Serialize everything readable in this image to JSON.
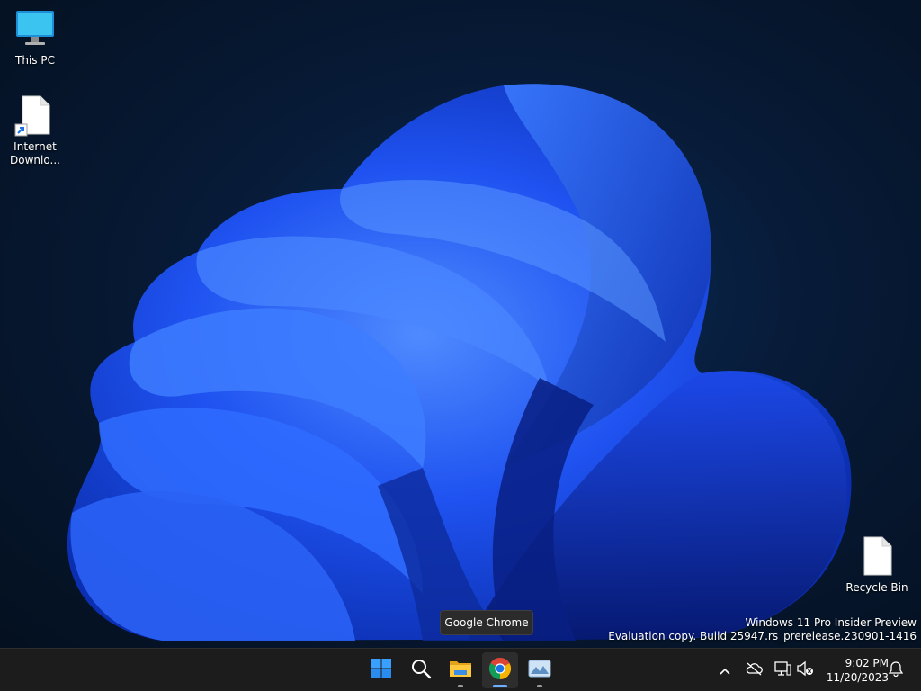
{
  "desktop": {
    "icons": [
      {
        "label": "This PC",
        "icon": "monitor-icon"
      },
      {
        "label": "Internet Downlo...",
        "icon": "file-shortcut-icon"
      },
      {
        "label": "Recycle Bin",
        "icon": "file-icon"
      }
    ],
    "watermark": {
      "line1": "Windows 11 Pro Insider Preview",
      "line2": "Evaluation copy. Build 25947.rs_prerelease.230901-1416"
    },
    "tooltip": "Google Chrome"
  },
  "taskbar": {
    "apps": [
      {
        "name": "Start",
        "icon": "windows-logo-icon"
      },
      {
        "name": "Search",
        "icon": "search-icon"
      },
      {
        "name": "File Explorer",
        "icon": "folder-icon"
      },
      {
        "name": "Google Chrome",
        "icon": "chrome-icon"
      },
      {
        "name": "Photos",
        "icon": "photos-icon"
      }
    ],
    "tray": {
      "icons": [
        "chevron-up-icon",
        "onedrive-icon",
        "network-icon",
        "volume-muted-icon",
        "notification-bell-icon"
      ],
      "time": "9:02 PM",
      "date": "11/20/2023"
    }
  },
  "colors": {
    "accent": "#1f5cff",
    "taskbar": "#1c1c1c",
    "chrome_blue": "#1a73e8"
  }
}
